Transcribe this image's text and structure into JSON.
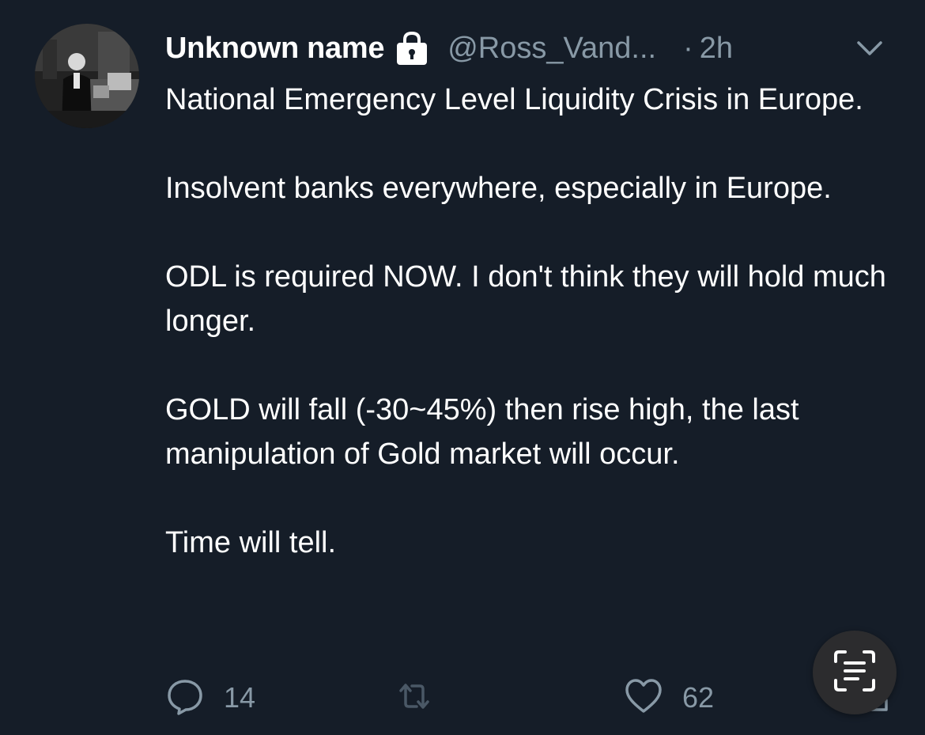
{
  "tweet": {
    "display_name": "Unknown name",
    "handle": "@Ross_Vand...",
    "separator": "·",
    "time": "2h",
    "paragraphs": [
      "National Emergency Level Liquidity Crisis in Europe.",
      "Insolvent banks everywhere, especially in Europe.",
      "ODL is required NOW. I don't think they will hold much longer.",
      "GOLD will fall (-30~45%) then rise high, the last manipulation of Gold market will occur.",
      "Time will tell."
    ]
  },
  "actions": {
    "reply_count": "14",
    "retweet_count": "",
    "like_count": "62"
  },
  "icons": {
    "lock": "lock-icon",
    "caret": "chevron-down-icon",
    "reply": "reply-icon",
    "retweet": "retweet-icon",
    "like": "heart-icon",
    "share": "share-icon",
    "scan": "live-text-icon"
  },
  "colors": {
    "background": "#151d28",
    "text_primary": "#ffffff",
    "text_secondary": "#8899a6"
  }
}
